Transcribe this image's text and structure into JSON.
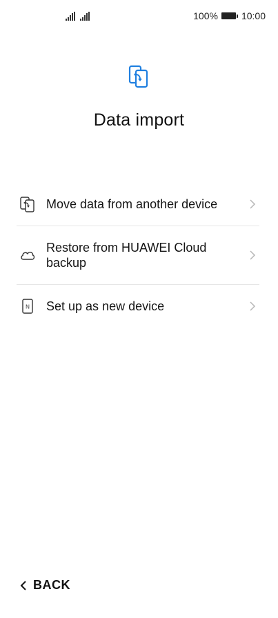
{
  "status_bar": {
    "battery": "100%",
    "time": "10:00"
  },
  "header": {
    "title": "Data import"
  },
  "options": [
    {
      "label": "Move data from another device",
      "icon": "phone-transfer-icon"
    },
    {
      "label": "Restore from HUAWEI Cloud backup",
      "icon": "cloud-icon"
    },
    {
      "label": "Set up as new device",
      "icon": "new-device-icon",
      "badge": "N"
    }
  ],
  "footer": {
    "back_label": "BACK"
  },
  "colors": {
    "accent": "#1f7fe0",
    "text": "#151515",
    "divider": "#e6e6e6",
    "chevron": "#b7b7b7"
  }
}
